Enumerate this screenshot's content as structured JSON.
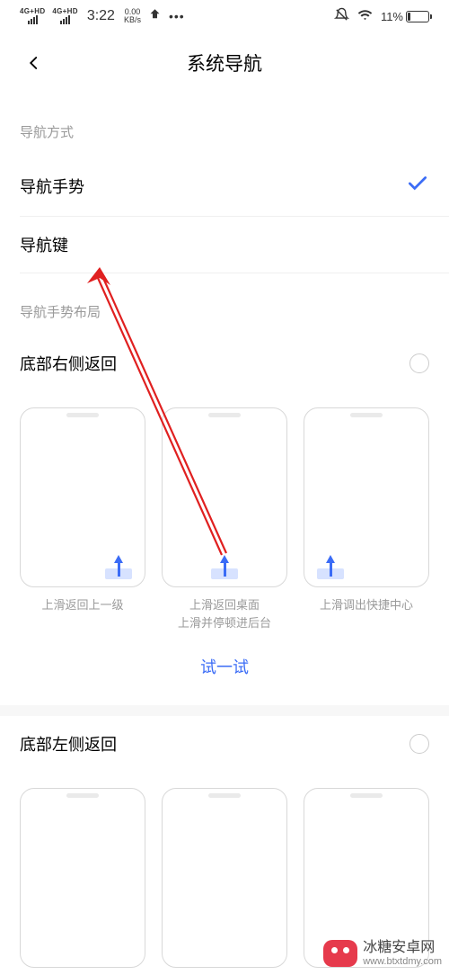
{
  "status": {
    "signal_mode": "4G+HD",
    "time": "3:22",
    "speed_value": "0.00",
    "speed_unit": "KB/s",
    "battery_percent": "11%"
  },
  "header": {
    "title": "系统导航"
  },
  "sections": {
    "nav_mode_label": "导航方式",
    "options": {
      "gesture": "导航手势",
      "keys": "导航键"
    },
    "gesture_layout_label": "导航手势布局",
    "layouts": {
      "bottom_right": "底部右侧返回",
      "bottom_left": "底部左侧返回"
    },
    "captions": {
      "c1": "上滑返回上一级",
      "c2a": "上滑返回桌面",
      "c2b": "上滑并停顿进后台",
      "c3": "上滑调出快捷中心"
    },
    "try_button": "试一试"
  },
  "watermark": {
    "line1": "冰糖安卓网",
    "line2": "www.btxtdmy.com"
  }
}
